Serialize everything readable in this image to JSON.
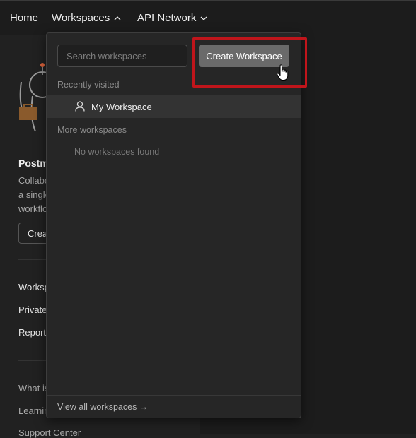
{
  "topnav": {
    "home": "Home",
    "workspaces": "Workspaces",
    "api_network": "API Network"
  },
  "background": {
    "title": "Postm",
    "desc_lines": [
      "Collabo",
      "a single",
      "workflo"
    ],
    "button": "Crea",
    "links": [
      "Worksp",
      "Private",
      "Report"
    ],
    "footer_links": [
      "What is",
      "Learnin",
      "Support Center"
    ]
  },
  "dropdown": {
    "search_placeholder": "Search workspaces",
    "create_button": "Create Workspace",
    "recently_visited_label": "Recently visited",
    "recent_items": [
      {
        "name": "My Workspace",
        "icon": "person-icon"
      }
    ],
    "more_workspaces_label": "More workspaces",
    "empty_message": "No workspaces found",
    "view_all": "View all workspaces →"
  },
  "colors": {
    "highlight": "#c0151b",
    "create_button_bg": "#6a6a6a"
  }
}
